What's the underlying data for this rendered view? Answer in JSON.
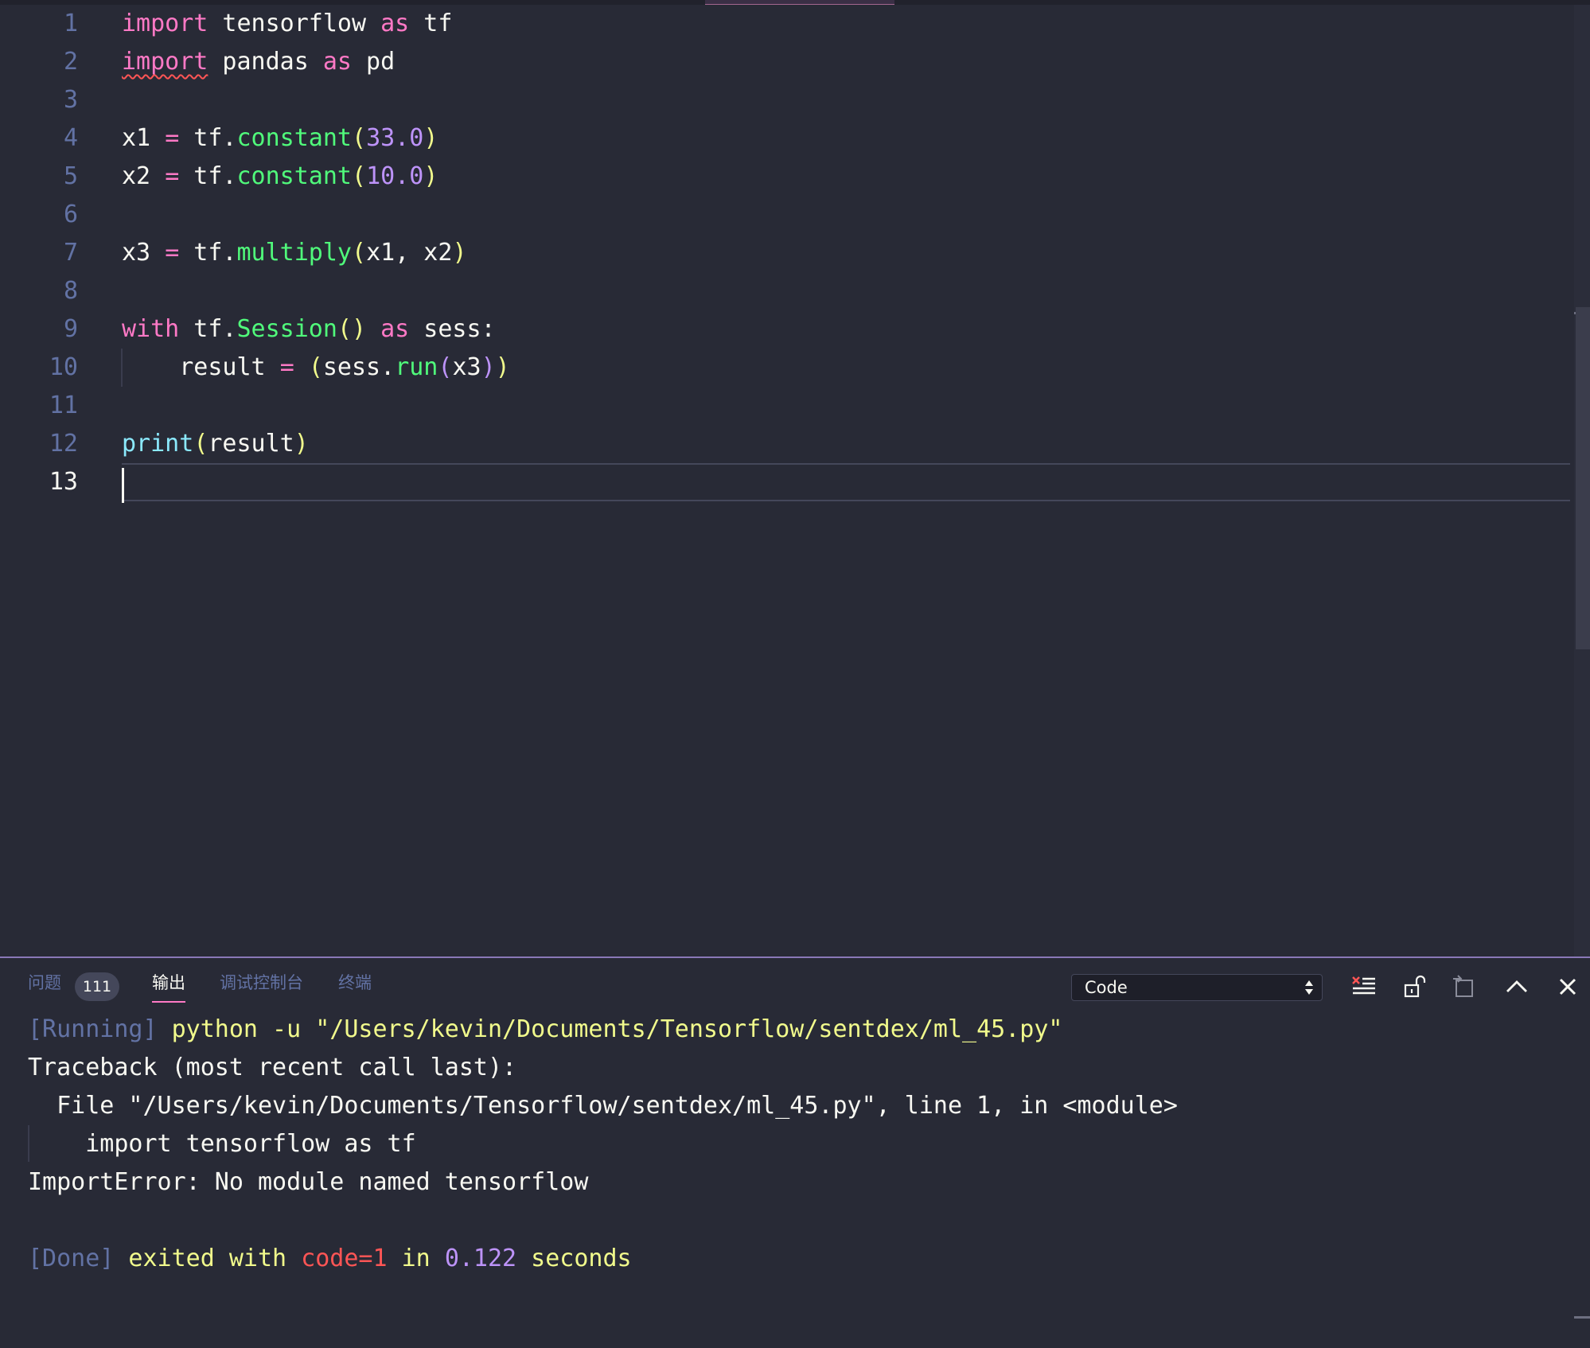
{
  "editor": {
    "line_numbers": [
      "1",
      "2",
      "3",
      "4",
      "5",
      "6",
      "7",
      "8",
      "9",
      "10",
      "11",
      "12",
      "13"
    ],
    "current_line": "13"
  },
  "code": {
    "l1": {
      "kw1": "import",
      "t1": " tensorflow ",
      "kw2": "as",
      "t2": " tf"
    },
    "l2": {
      "kw1": "import",
      "t1": " pandas ",
      "kw2": "as",
      "t2": " pd"
    },
    "l4": {
      "t1": "x1 ",
      "op": "=",
      "t2": " tf.",
      "fn": "constant",
      "p1": "(",
      "num": "33.0",
      "p2": ")"
    },
    "l5": {
      "t1": "x2 ",
      "op": "=",
      "t2": " tf.",
      "fn": "constant",
      "p1": "(",
      "num": "10.0",
      "p2": ")"
    },
    "l7": {
      "t1": "x3 ",
      "op": "=",
      "t2": " tf.",
      "fn": "multiply",
      "p1": "(",
      "args": "x1, x2",
      "p2": ")"
    },
    "l9": {
      "kw1": "with",
      "t1": " tf.",
      "fn": "Session",
      "p": "()",
      "kw2": " as",
      "t2": " sess:"
    },
    "l10": {
      "t1": "    result ",
      "op": "=",
      "sp": " ",
      "p1": "(",
      "t2": "sess.",
      "fn": "run",
      "p2": "(",
      "arg": "x3",
      "p3": ")",
      "p4": ")"
    },
    "l12": {
      "bi": "print",
      "p1": "(",
      "arg": "result",
      "p2": ")"
    }
  },
  "panel": {
    "tabs": {
      "problems": "问题",
      "problems_count": "111",
      "output": "输出",
      "debug_console": "调试控制台",
      "terminal": "终端"
    },
    "output_channel": "Code",
    "icons": [
      "clear-output-icon",
      "lock-scroll-icon",
      "open-log-icon",
      "maximize-panel-icon",
      "close-panel-icon"
    ]
  },
  "output": {
    "l1": {
      "tag": "[Running]",
      "cmd": " python -u \"/Users/kevin/Documents/Tensorflow/sentdex/ml_45.py\""
    },
    "l2": "Traceback (most recent call last):",
    "l3": "  File \"/Users/kevin/Documents/Tensorflow/sentdex/ml_45.py\", line 1, in <module>",
    "l4": "    import tensorflow as tf",
    "l5": "ImportError: No module named tensorflow",
    "l7": {
      "tag": "[Done]",
      "t1": " exited with ",
      "code": "code=1",
      "t2": " in ",
      "secs": "0.122",
      "t3": " seconds"
    }
  },
  "colors": {
    "background": "#282a36",
    "keyword": "#ff79c6",
    "function": "#50fa7b",
    "builtin": "#8be9fd",
    "number": "#bd93f9",
    "bracket": "#f1fa8c",
    "line_number": "#6272a4",
    "error": "#ff5555"
  }
}
